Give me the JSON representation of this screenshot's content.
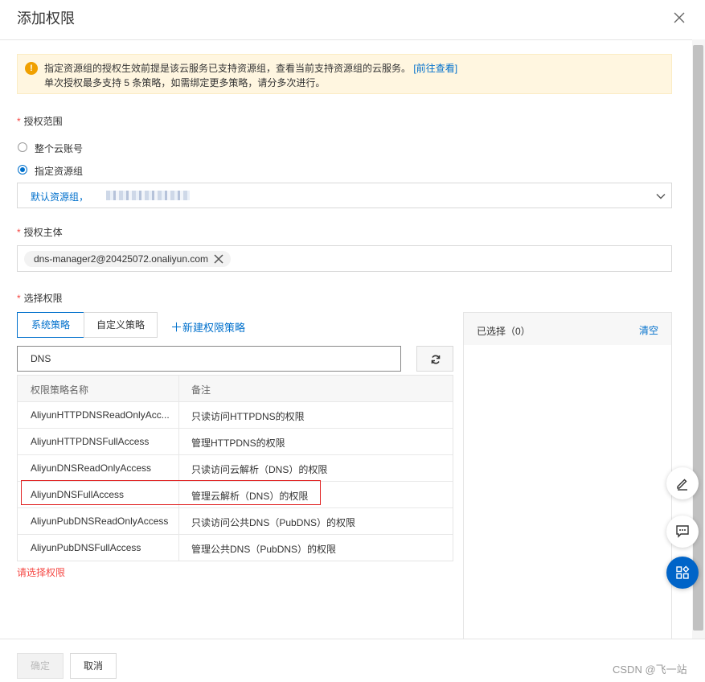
{
  "dialog": {
    "title": "添加权限"
  },
  "notice": {
    "line1": "指定资源组的授权生效前提是该云服务已支持资源组，查看当前支持资源组的云服务。",
    "link": "[前往查看]",
    "line2": "单次授权最多支持 5 条策略，如需绑定更多策略，请分多次进行。"
  },
  "scope": {
    "label": "授权范围",
    "options": [
      "整个云账号",
      "指定资源组"
    ],
    "selected": "指定资源组",
    "resource_group": "默认资源组，"
  },
  "principal": {
    "label": "授权主体",
    "tag": "dns-manager2@20425072.onaliyun.com"
  },
  "permissions": {
    "label": "选择权限",
    "tabs": [
      "系统策略",
      "自定义策略"
    ],
    "active_tab": "系统策略",
    "new_policy": "新建权限策略",
    "search_value": "DNS",
    "columns": [
      "权限策略名称",
      "备注"
    ],
    "rows": [
      {
        "name": "AliyunHTTPDNSReadOnlyAcc...",
        "note": "只读访问HTTPDNS的权限"
      },
      {
        "name": "AliyunHTTPDNSFullAccess",
        "note": "管理HTTPDNS的权限"
      },
      {
        "name": "AliyunDNSReadOnlyAccess",
        "note": "只读访问云解析（DNS）的权限"
      },
      {
        "name": "AliyunDNSFullAccess",
        "note": "管理云解析（DNS）的权限"
      },
      {
        "name": "AliyunPubDNSReadOnlyAccess",
        "note": "只读访问公共DNS（PubDNS）的权限"
      },
      {
        "name": "AliyunPubDNSFullAccess",
        "note": "管理公共DNS（PubDNS）的权限"
      }
    ],
    "error": "请选择权限"
  },
  "selected_panel": {
    "title": "已选择（0）",
    "clear": "清空"
  },
  "footer": {
    "confirm": "确定",
    "cancel": "取消",
    "watermark": "CSDN @飞一站"
  },
  "colors": {
    "accent": "#0070cc",
    "error": "#f54743",
    "warning": "#f0a000",
    "fab": "#0064c8"
  }
}
